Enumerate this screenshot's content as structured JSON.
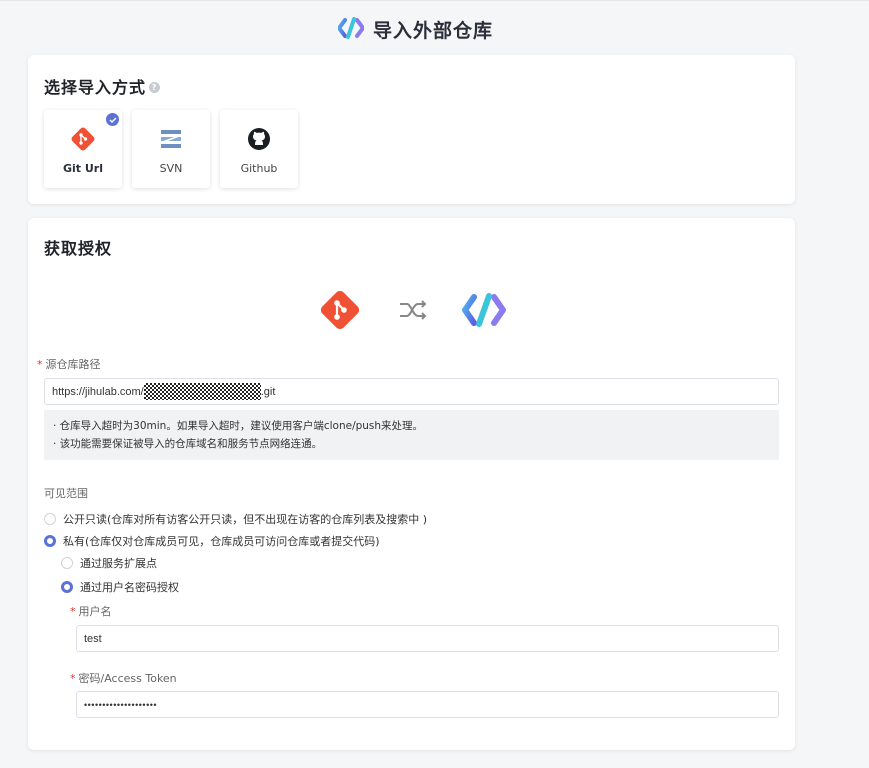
{
  "header": {
    "title": "导入外部仓库",
    "logo_icon": "jihulab-logo-icon"
  },
  "import_method": {
    "title": "选择导入方式",
    "help_icon": "help-circle-icon",
    "options": [
      {
        "label": "Git Url",
        "icon": "git-icon",
        "selected": true
      },
      {
        "label": "SVN",
        "icon": "svn-icon",
        "selected": false
      },
      {
        "label": "Github",
        "icon": "github-icon",
        "selected": false
      }
    ]
  },
  "auth": {
    "title": "获取授权",
    "source_icon": "git-icon",
    "transfer_icon": "shuffle-icon",
    "target_icon": "jihulab-logo-icon",
    "repo_path": {
      "label": "源仓库路径",
      "value_prefix": "https://jihulab.com/",
      "value_suffix": ".git"
    },
    "notices": [
      "· 仓库导入超时为30min。如果导入超时，建议使用客户端clone/push来处理。",
      "· 该功能需要保证被导入的仓库域名和服务节点网络连通。"
    ],
    "visibility": {
      "label": "可见范围",
      "public_label": "公开只读(仓库对所有访客公开只读，但不出现在访客的仓库列表及搜索中 )",
      "public_selected": false,
      "private_label": "私有(仓库仅对仓库成员可见，仓库成员可访问仓库或者提交代码)",
      "private_selected": true,
      "sub_options": [
        {
          "label": "通过服务扩展点",
          "selected": false
        },
        {
          "label": "通过用户名密码授权",
          "selected": true
        }
      ]
    },
    "username": {
      "label": "用户名",
      "value": "test"
    },
    "password": {
      "label": "密码/Access Token",
      "value": "••••••••••••••••••••"
    }
  },
  "colors": {
    "accent": "#5b72d8",
    "git": "#f05033",
    "required": "#e0362c"
  }
}
